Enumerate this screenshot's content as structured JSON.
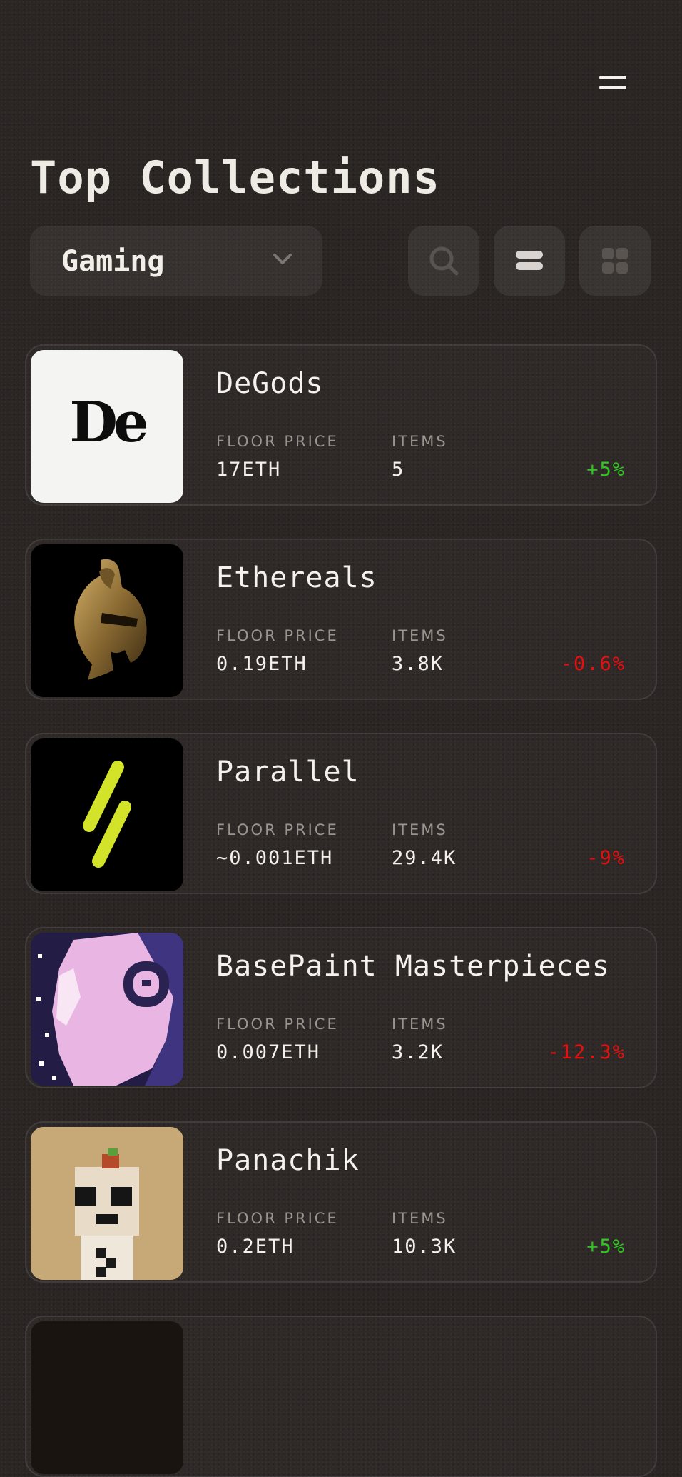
{
  "header": {
    "title": "Top Collections",
    "menu_icon": "hamburger-menu-icon"
  },
  "filter": {
    "selected": "Gaming"
  },
  "toolbar": {
    "icons": [
      "search-icon",
      "list-view-icon",
      "grid-view-icon"
    ]
  },
  "labels": {
    "floor_price": "FLOOR PRICE",
    "items": "ITEMS"
  },
  "colors": {
    "positive": "#2ec71f",
    "negative": "#e60f0f"
  },
  "collections": [
    {
      "name": "DeGods",
      "floor_price": "17ETH",
      "items": "5",
      "change": "+5%",
      "logo_text": "De"
    },
    {
      "name": "Ethereals",
      "floor_price": "0.19ETH",
      "items": "3.8K",
      "change": "-0.6%"
    },
    {
      "name": "Parallel",
      "floor_price": "~0.001ETH",
      "items": "29.4K",
      "change": "-9%"
    },
    {
      "name": "BasePaint Masterpieces",
      "floor_price": "0.007ETH",
      "items": "3.2K",
      "change": "-12.3%"
    },
    {
      "name": "Panachik",
      "floor_price": "0.2ETH",
      "items": "10.3K",
      "change": "+5%"
    }
  ]
}
